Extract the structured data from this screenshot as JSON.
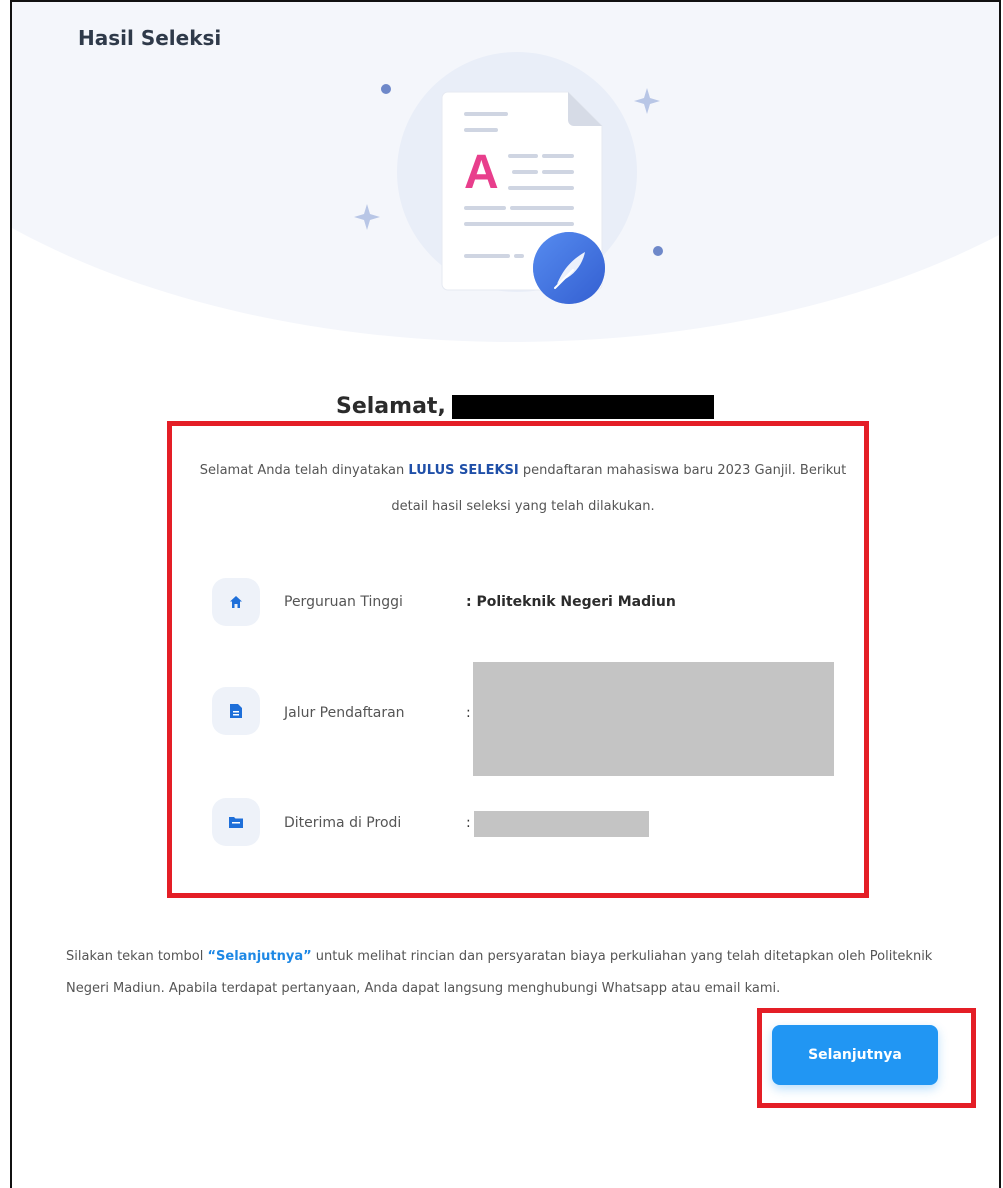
{
  "page": {
    "title": "Hasil Seleksi"
  },
  "greeting": {
    "text": "Selamat,"
  },
  "intro": {
    "before": "Selamat Anda telah dinyatakan ",
    "highlight": "LULUS SELEKSI",
    "after": " pendaftaran mahasiswa baru 2023 Ganjil. Berikut detail hasil seleksi yang telah dilakukan."
  },
  "details": [
    {
      "icon": "home-icon",
      "label": "Perguruan Tinggi",
      "value": ": Politeknik Negeri Madiun"
    },
    {
      "icon": "document-icon",
      "label": "Jalur Pendaftaran",
      "value": ":"
    },
    {
      "icon": "folder-icon",
      "label": "Diterima di Prodi",
      "value": ":"
    }
  ],
  "note": {
    "before": "Silakan tekan tombol ",
    "link": "“Selanjutnya”",
    "after": " untuk melihat rincian dan persyaratan biaya perkuliahan yang telah ditetapkan oleh Politeknik Negeri Madiun. Apabila terdapat pertanyaan, Anda dapat langsung menghubungi Whatsapp atau email kami."
  },
  "button": {
    "label": "Selanjutnya"
  },
  "colors": {
    "accent": "#1e88e5",
    "highlight_box": "#e41e26",
    "heading": "#1f4fa8"
  }
}
